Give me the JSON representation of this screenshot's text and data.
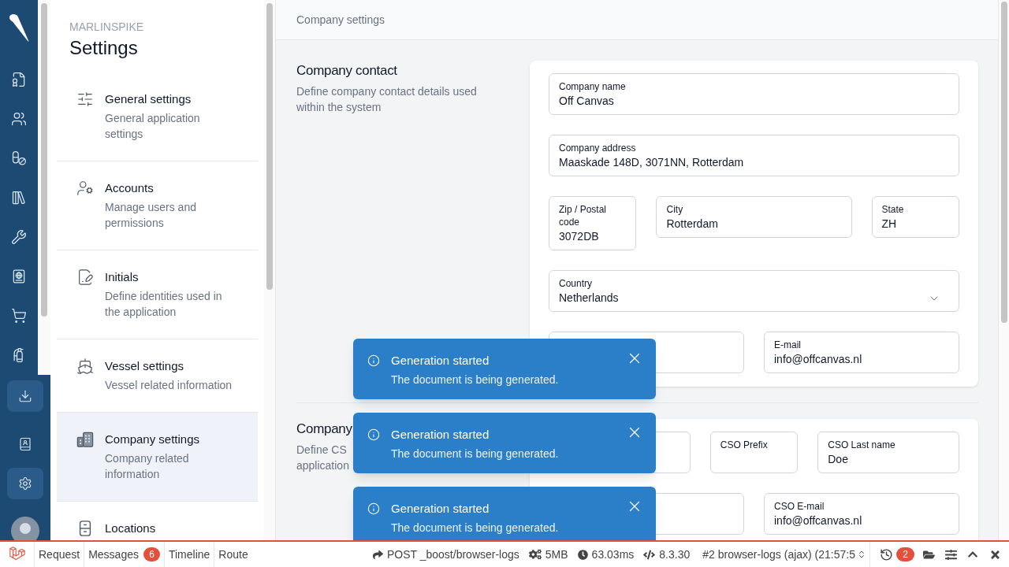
{
  "rail": {
    "top_items": [
      {
        "selected": false
      },
      {
        "selected": false
      },
      {
        "selected": false
      },
      {
        "selected": false
      },
      {
        "selected": false
      },
      {
        "selected": false
      },
      {
        "selected": false
      },
      {
        "selected": false
      }
    ],
    "bottom_items": [
      {
        "selected": true
      },
      {
        "selected": false
      },
      {
        "selected": true
      }
    ]
  },
  "settings_nav": {
    "brand": "MARLINSPIKE",
    "title": "Settings",
    "items": [
      {
        "title": "General settings",
        "description": "General application settings",
        "selected": false
      },
      {
        "title": "Accounts",
        "description": "Manage users and permissions",
        "selected": false
      },
      {
        "title": "Initials",
        "description": "Define identities used in the application",
        "selected": false
      },
      {
        "title": "Vessel settings",
        "description": "Vessel related information",
        "selected": false
      },
      {
        "title": "Company settings",
        "description": "Company related information",
        "selected": true
      },
      {
        "title": "Locations",
        "selected": false
      }
    ]
  },
  "main": {
    "header": "Company settings",
    "sections": [
      {
        "title": "Company contact",
        "description": "Define company contact details used within the system",
        "rows": [
          [
            {
              "kind": "text",
              "label": "Company name",
              "value": "Off Canvas"
            }
          ],
          [
            {
              "kind": "text",
              "label": "Company address",
              "value": "Maaskade 148D, 3071NN, Rotterdam"
            }
          ],
          [
            {
              "kind": "text",
              "label": "Zip / Postal code",
              "value": "3072DB"
            },
            {
              "kind": "text",
              "label": "City",
              "value": "Rotterdam"
            },
            {
              "kind": "text",
              "label": "State",
              "value": "ZH"
            }
          ],
          [
            {
              "kind": "select",
              "label": "Country",
              "value": "Netherlands"
            }
          ],
          [
            {
              "kind": "text"
            },
            {
              "kind": "text",
              "label": "E-mail",
              "value": "info@offcanvas.nl"
            }
          ]
        ]
      },
      {
        "title": "Company",
        "description_parts": [
          "Define CS",
          "application"
        ],
        "rows": [
          [
            {
              "kind": "text"
            },
            {
              "kind": "text",
              "label": "CSO Prefix"
            },
            {
              "kind": "text",
              "label": "CSO Last name",
              "value": "Doe"
            }
          ],
          [
            {
              "kind": "text"
            },
            {
              "kind": "text",
              "label": "CSO E-mail",
              "value": "info@offcanvas.nl"
            }
          ]
        ]
      }
    ]
  },
  "toasts": [
    {
      "title": "Generation started",
      "message": "The document is being generated."
    },
    {
      "title": "Generation started",
      "message": "The document is being generated."
    },
    {
      "title": "Generation started",
      "message": "The document is being generated."
    }
  ],
  "debug_bar": {
    "tabs": [
      {
        "label": "Request"
      },
      {
        "label": "Messages",
        "badge": "6"
      },
      {
        "label": "Timeline"
      },
      {
        "label": "Route"
      }
    ],
    "stats": [
      "POST _boost/browser-logs",
      "5MB",
      "63.03ms",
      "8.3.30"
    ],
    "request": "#2 browser-logs (ajax) (21:57:5",
    "history_count": "2"
  }
}
